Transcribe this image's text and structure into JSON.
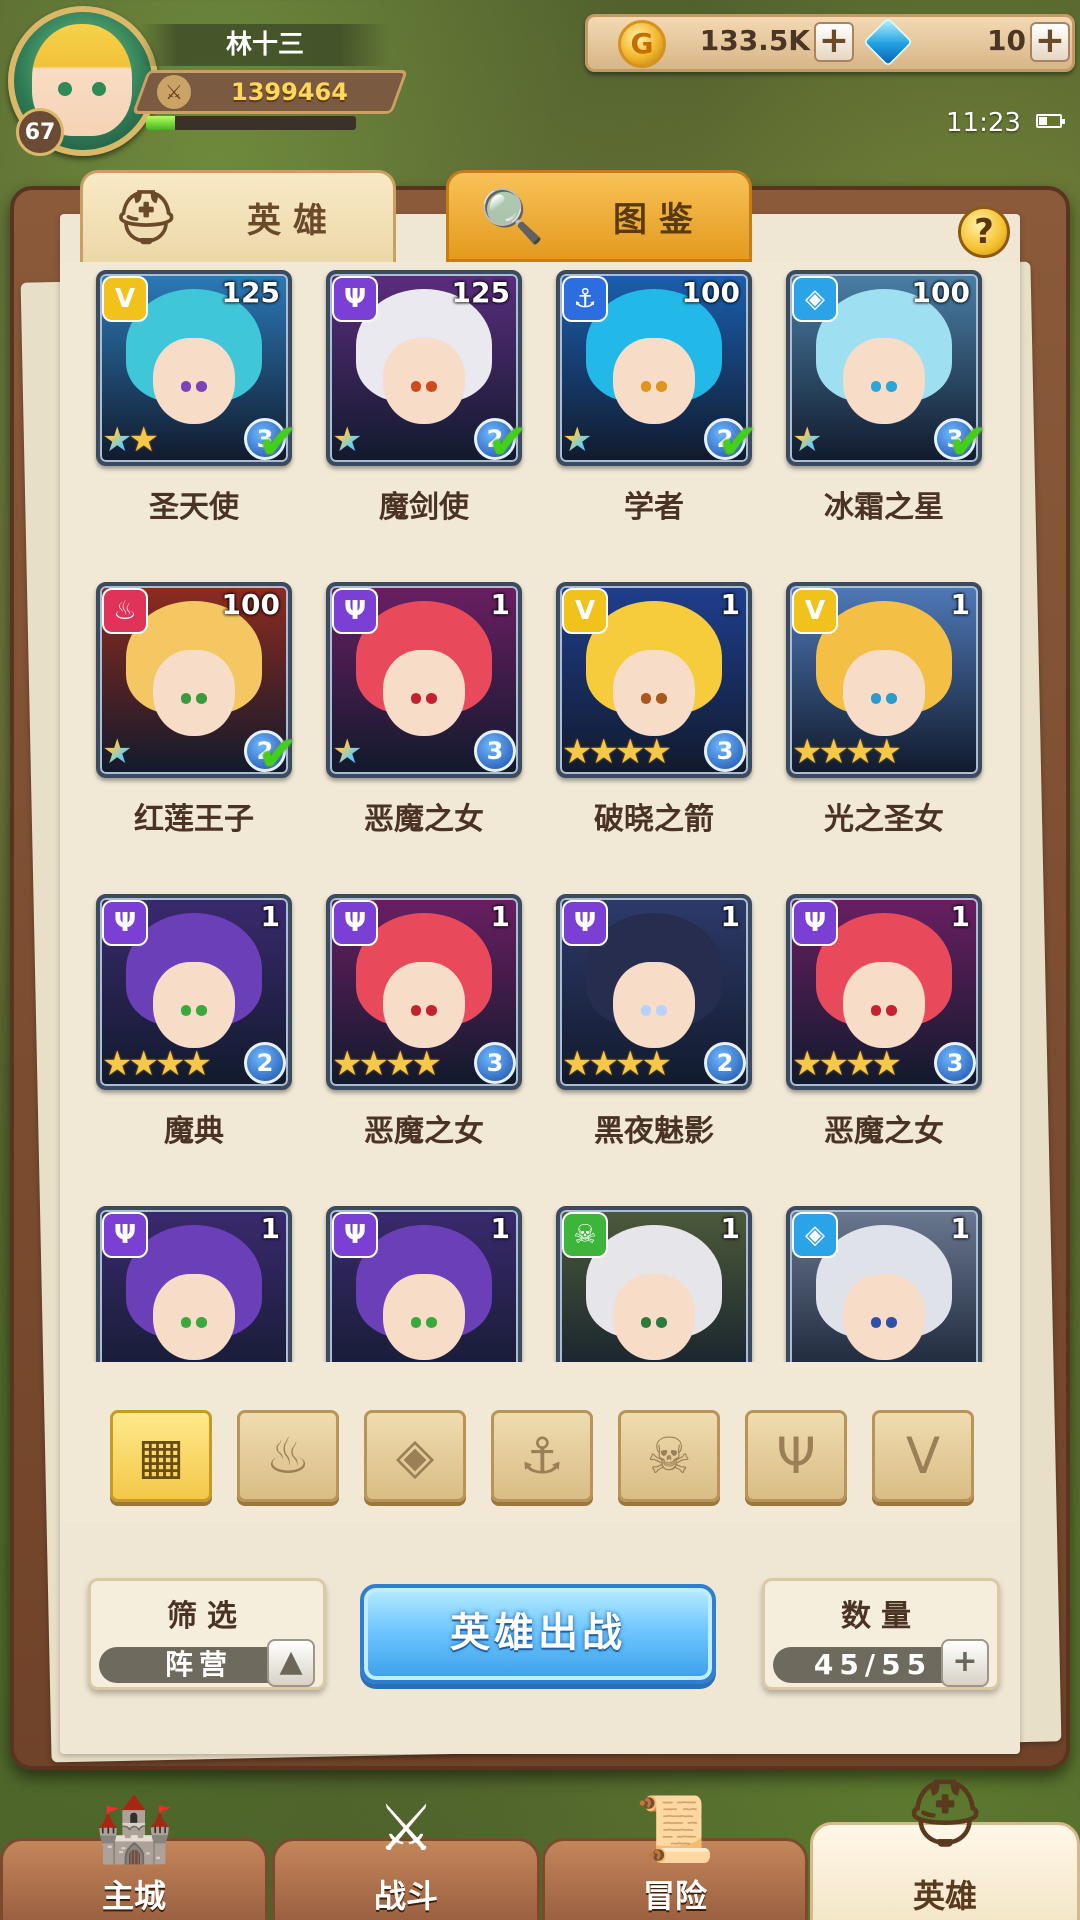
{
  "player": {
    "name": "林十三",
    "level": "67",
    "power": "1399464",
    "exp_fraction": 0.14
  },
  "resources": {
    "gold": "133.5K",
    "gems": "10",
    "gold_icon_label": "G"
  },
  "status": {
    "time": "11:23"
  },
  "tabs": {
    "heroes": "英雄",
    "handbook": "图鉴"
  },
  "help_label": "?",
  "heroes": [
    {
      "name": "圣天使",
      "level": "125",
      "faction": "light",
      "stars": 2,
      "rainbow_stars": 1,
      "rank": "3",
      "check": true,
      "hair": "#3fc6d9",
      "bg": "#2b7ab7",
      "eye": "#7a44b8"
    },
    {
      "name": "魔剑使",
      "level": "125",
      "faction": "dark",
      "stars": 1,
      "rainbow_stars": 1,
      "rank": "2",
      "check": true,
      "hair": "#e9e9ef",
      "bg": "#5a2d7e",
      "eye": "#d04a1e"
    },
    {
      "name": "学者",
      "level": "100",
      "faction": "anchor",
      "stars": 1,
      "rainbow_stars": 1,
      "rank": "2",
      "check": true,
      "hair": "#22b8e8",
      "bg": "#1a5fae",
      "eye": "#e0941a"
    },
    {
      "name": "冰霜之星",
      "level": "100",
      "faction": "frost",
      "stars": 1,
      "rainbow_stars": 1,
      "rank": "3",
      "check": true,
      "hair": "#9fdff2",
      "bg": "#4a7fa6",
      "eye": "#2aa6d8"
    },
    {
      "name": "红莲王子",
      "level": "100",
      "faction": "fire",
      "stars": 1,
      "rainbow_stars": 1,
      "rank": "2",
      "check": true,
      "hair": "#f4c763",
      "bg": "#8e2b1f",
      "eye": "#3c9a3a"
    },
    {
      "name": "恶魔之女",
      "level": "1",
      "faction": "dark",
      "stars": 1,
      "rainbow_stars": 1,
      "rank": "3",
      "check": false,
      "hair": "#e84a5c",
      "bg": "#6a1e62",
      "eye": "#c4222e"
    },
    {
      "name": "破晓之箭",
      "level": "1",
      "faction": "light",
      "stars": 4,
      "rainbow_stars": 0,
      "rank": "3",
      "check": false,
      "hair": "#f6cc3c",
      "bg": "#1f3f8e",
      "eye": "#a9571c"
    },
    {
      "name": "光之圣女",
      "level": "1",
      "faction": "light",
      "stars": 4,
      "rainbow_stars": 0,
      "rank": "",
      "check": false,
      "hair": "#f3bf45",
      "bg": "#4f79b8",
      "eye": "#2c9acb"
    },
    {
      "name": "魔典",
      "level": "1",
      "faction": "dark",
      "stars": 4,
      "rainbow_stars": 0,
      "rank": "2",
      "check": false,
      "hair": "#6b3fb8",
      "bg": "#3a2a6e",
      "eye": "#3aa83a"
    },
    {
      "name": "恶魔之女",
      "level": "1",
      "faction": "dark",
      "stars": 4,
      "rainbow_stars": 0,
      "rank": "3",
      "check": false,
      "hair": "#e84a5c",
      "bg": "#6a1e62",
      "eye": "#c4222e"
    },
    {
      "name": "黑夜魅影",
      "level": "1",
      "faction": "dark",
      "stars": 4,
      "rainbow_stars": 0,
      "rank": "2",
      "check": false,
      "hair": "#272d4e",
      "bg": "#2e3a6a",
      "eye": "#b8d2ff"
    },
    {
      "name": "恶魔之女",
      "level": "1",
      "faction": "dark",
      "stars": 4,
      "rainbow_stars": 0,
      "rank": "3",
      "check": false,
      "hair": "#e84a5c",
      "bg": "#6a1e62",
      "eye": "#c4222e"
    },
    {
      "name": "",
      "level": "1",
      "faction": "dark",
      "stars": 0,
      "rainbow_stars": 0,
      "rank": "",
      "check": false,
      "hair": "#6b3fb8",
      "bg": "#3a2a6e",
      "eye": "#3aa83a"
    },
    {
      "name": "",
      "level": "1",
      "faction": "dark",
      "stars": 0,
      "rainbow_stars": 0,
      "rank": "",
      "check": false,
      "hair": "#6b3fb8",
      "bg": "#3a2a6e",
      "eye": "#3aa83a"
    },
    {
      "name": "",
      "level": "1",
      "faction": "beast",
      "stars": 0,
      "rainbow_stars": 0,
      "rank": "",
      "check": false,
      "hair": "#e6e6ea",
      "bg": "#4c5a3a",
      "eye": "#2d7a3a"
    },
    {
      "name": "",
      "level": "1",
      "faction": "frost",
      "stars": 0,
      "rainbow_stars": 0,
      "rank": "",
      "check": false,
      "hair": "#dfe2e8",
      "bg": "#6a7890",
      "eye": "#2f4fa8"
    }
  ],
  "factions": {
    "light": {
      "color": "#f1c21b",
      "glyph": "V"
    },
    "dark": {
      "color": "#7b3fd4",
      "glyph": "Ψ"
    },
    "anchor": {
      "color": "#2c6ee0",
      "glyph": "⚓"
    },
    "frost": {
      "color": "#2aa3e8",
      "glyph": "◈"
    },
    "fire": {
      "color": "#e0335a",
      "glyph": "♨"
    },
    "beast": {
      "color": "#3cb53a",
      "glyph": "☠"
    }
  },
  "filter_bar": [
    {
      "icon": "all-grid-icon",
      "glyph": "▦",
      "active": true
    },
    {
      "icon": "fire-faction-icon",
      "glyph": "♨",
      "active": false
    },
    {
      "icon": "frost-faction-icon",
      "glyph": "◈",
      "active": false
    },
    {
      "icon": "anchor-faction-icon",
      "glyph": "⚓",
      "active": false
    },
    {
      "icon": "beast-faction-icon",
      "glyph": "☠",
      "active": false
    },
    {
      "icon": "dark-faction-icon",
      "glyph": "Ψ",
      "active": false
    },
    {
      "icon": "light-faction-icon",
      "glyph": "V",
      "active": false
    }
  ],
  "controls": {
    "filter_title": "筛选",
    "filter_value": "阵营",
    "deploy_label": "英雄出战",
    "count_title": "数量",
    "count_value": "45/55"
  },
  "nav": [
    {
      "label": "主城",
      "icon": "castle-icon",
      "glyph": "🏰",
      "active": false
    },
    {
      "label": "战斗",
      "icon": "crossed-swords-icon",
      "glyph": "⚔",
      "active": false
    },
    {
      "label": "冒险",
      "icon": "scroll-map-icon",
      "glyph": "📜",
      "active": false
    },
    {
      "label": "英雄",
      "icon": "helmet-icon",
      "glyph": "⛑",
      "active": true
    }
  ],
  "colors": {
    "accent_gold": "#f3c84a",
    "deploy_blue": "#3c9fea",
    "check_green": "#42d11a"
  }
}
